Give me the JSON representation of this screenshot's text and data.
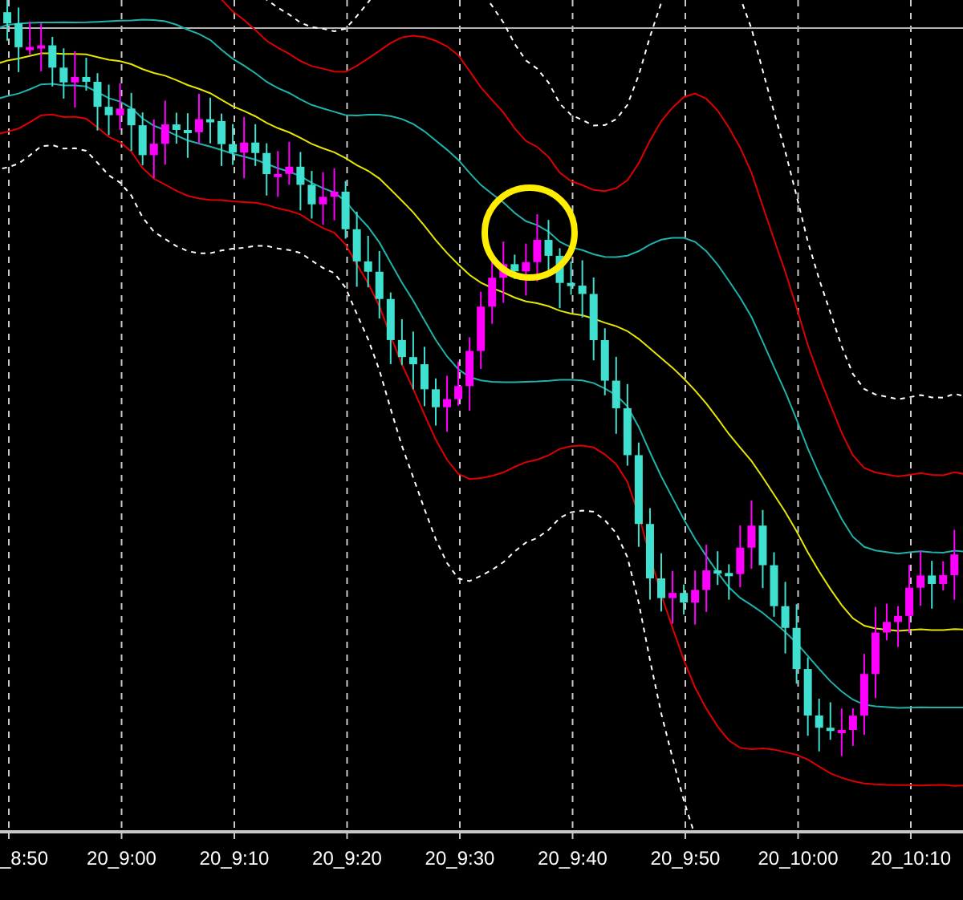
{
  "chart": {
    "x_axis_labels": [
      "_8:50",
      "20_9:00",
      "20_9:10",
      "20_9:20",
      "20_9:30",
      "20_9:40",
      "20_9:50",
      "20_10:00",
      "20_10:10"
    ]
  }
}
